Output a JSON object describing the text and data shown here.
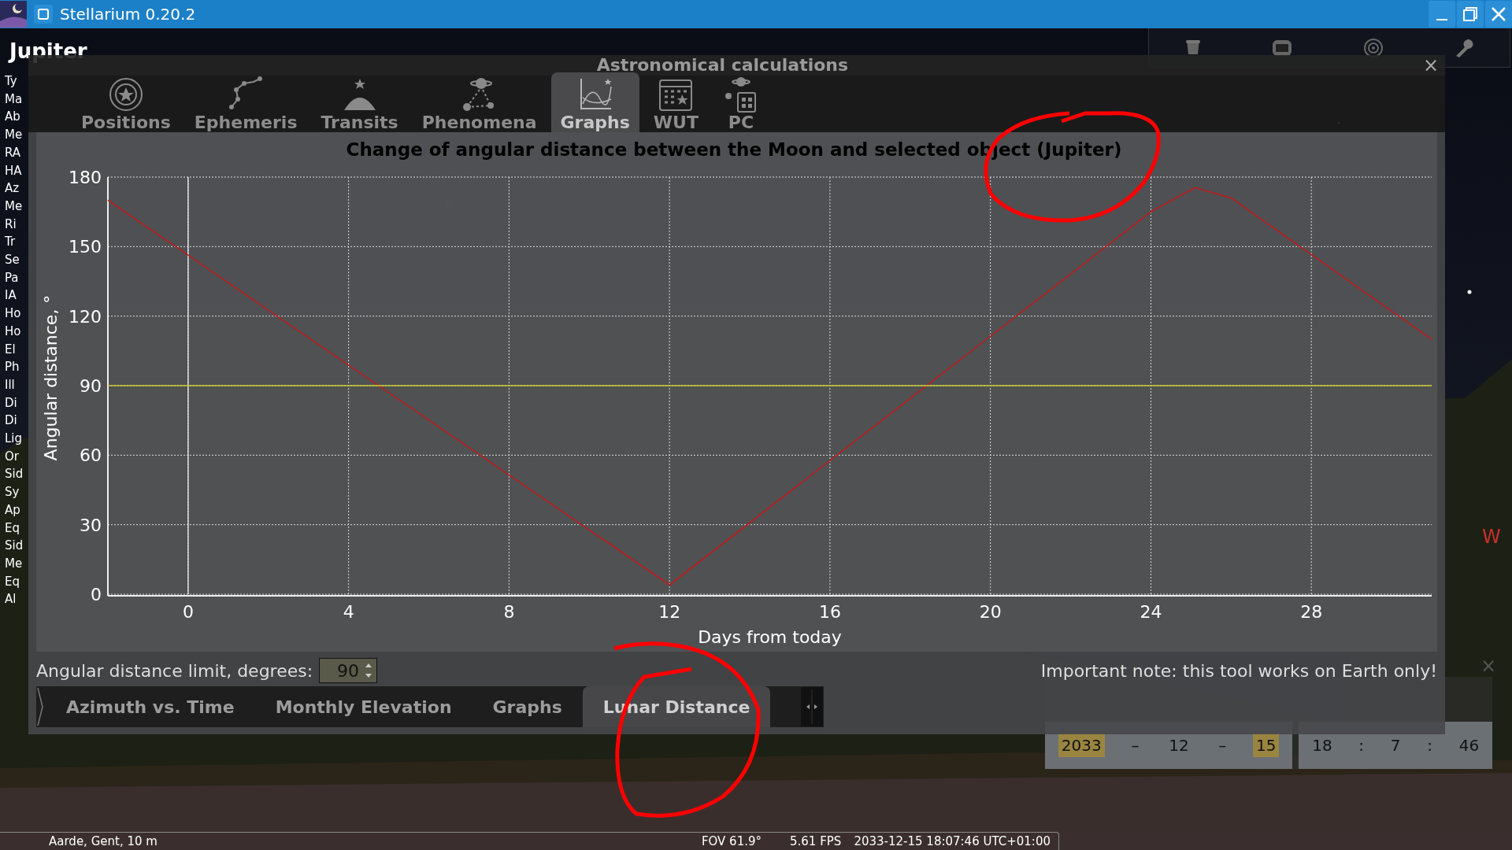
{
  "window": {
    "title": "Stellarium 0.20.2"
  },
  "object": {
    "name": "Jupiter",
    "lines": [
      "Ty",
      "Ma",
      "Ab",
      "Me",
      "RA",
      "HA",
      "Az",
      "Me",
      "Ri",
      "Tr",
      "Se",
      "Pa",
      "IA",
      "Ho",
      "Ho",
      "El",
      "Ph",
      "Ill",
      "Di",
      "Di",
      "Lig",
      "Or",
      "Sid",
      "Sy",
      "Ap",
      "Eq",
      "Sid",
      "Me",
      "Eq",
      "Al"
    ]
  },
  "sky_labels": [
    {
      "text": "W",
      "kind": "cardinal"
    }
  ],
  "date_window": {
    "date": [
      {
        "value": "2033",
        "selected": true
      },
      {
        "value": "12",
        "selected": false
      },
      {
        "value": "15",
        "selected": true
      }
    ],
    "date_sep": "–",
    "time": [
      "18",
      "7",
      "46"
    ],
    "time_sep": ":",
    "close": "×"
  },
  "dialog": {
    "title": "Astronomical calculations",
    "close": "×",
    "tabs": [
      {
        "label": "Positions",
        "selected": false
      },
      {
        "label": "Ephemeris",
        "selected": false
      },
      {
        "label": "Transits",
        "selected": false
      },
      {
        "label": "Phenomena",
        "selected": false
      },
      {
        "label": "Graphs",
        "selected": true
      },
      {
        "label": "WUT",
        "selected": false
      },
      {
        "label": "PC",
        "selected": false
      }
    ],
    "chart_data": {
      "type": "line",
      "title": "Change of angular distance between the Moon and selected object (Jupiter)",
      "xlabel": "Days from today",
      "ylabel": "Angular distance, °",
      "x": [
        -2,
        12,
        24,
        25.1,
        26,
        31
      ],
      "series": [
        {
          "color": "#c41a1a",
          "values": [
            170,
            4,
            165,
            175.5,
            171,
            110
          ]
        },
        {
          "color": "#c8c830",
          "values": [
            90,
            90,
            90,
            90,
            90,
            90
          ]
        }
      ],
      "grid": true,
      "xlim": [
        -2,
        31
      ],
      "ylim": [
        0,
        180
      ],
      "xticks": [
        0,
        4,
        8,
        12,
        16,
        20,
        24,
        28
      ],
      "yticks": [
        0,
        30,
        60,
        90,
        120,
        150,
        180
      ]
    },
    "limit": {
      "label": "Angular distance limit, degrees:",
      "value": "90"
    },
    "note": "Important note: this tool works on Earth only!",
    "subtabs": [
      {
        "label": "Azimuth vs. Time",
        "selected": false
      },
      {
        "label": "Monthly Elevation",
        "selected": false
      },
      {
        "label": "Graphs",
        "selected": false
      },
      {
        "label": "Lunar Distance",
        "selected": true
      }
    ]
  },
  "status_bar": {
    "location": "Aarde, Gent, 10 m",
    "fov": "FOV 61.9°",
    "fps": "5.61 FPS",
    "datetime": "2033-12-15 18:07:46 UTC+01:00"
  }
}
